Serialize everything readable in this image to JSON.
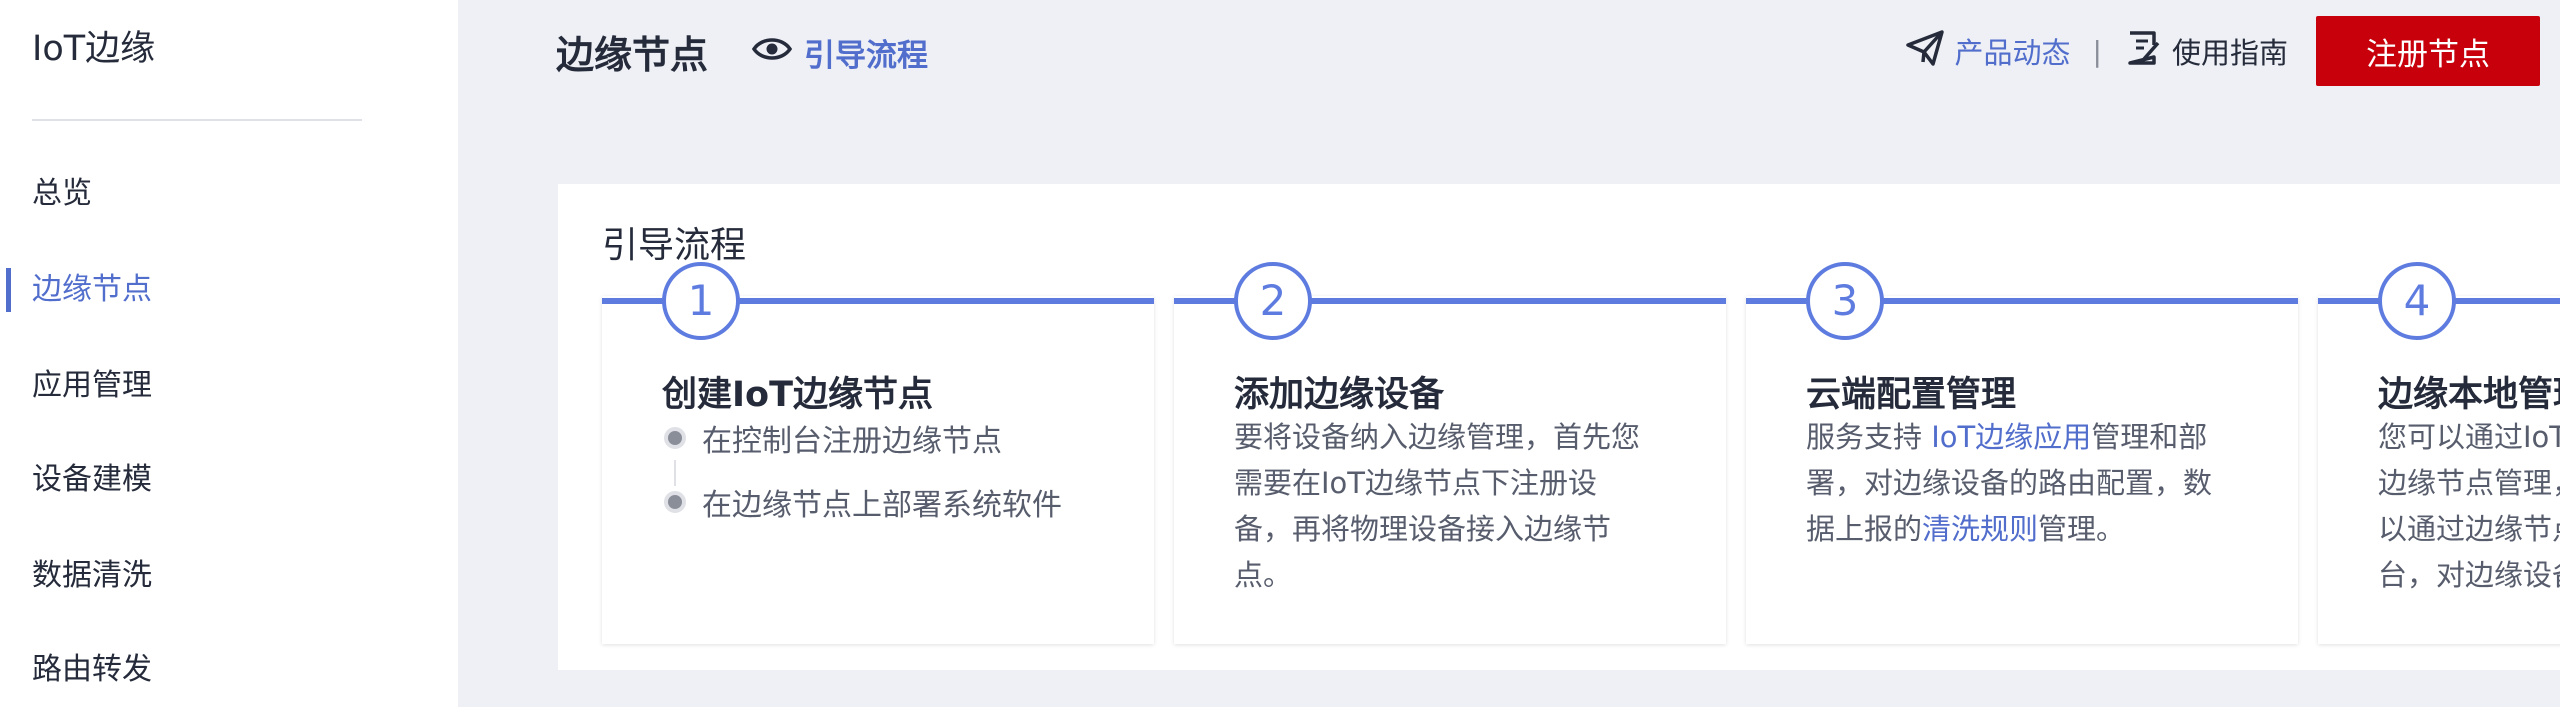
{
  "sidebar": {
    "app_title": "IoT边缘",
    "items": [
      {
        "label": "总览",
        "active": false
      },
      {
        "label": "边缘节点",
        "active": true
      },
      {
        "label": "应用管理",
        "active": false
      },
      {
        "label": "设备建模",
        "active": false
      },
      {
        "label": "数据清洗",
        "active": false
      },
      {
        "label": "路由转发",
        "active": false
      }
    ]
  },
  "header": {
    "title": "边缘节点",
    "guide_link": "引导流程",
    "news_link": "产品动态",
    "separator": "|",
    "guide_doc_link": "使用指南",
    "register_button": "注册节点"
  },
  "guide": {
    "title": "引导流程",
    "steps": [
      {
        "number": "1",
        "title": "创建IoT边缘节点",
        "bullets": [
          "在控制台注册边缘节点",
          "在边缘节点上部署系统软件"
        ]
      },
      {
        "number": "2",
        "title": "添加边缘设备",
        "desc": "要将设备纳入边缘管理，首先您需要在IoT边缘节点下注册设备，再将物理设备接入边缘节点。"
      },
      {
        "number": "3",
        "title": "云端配置管理",
        "desc_pre": "服务支持 ",
        "desc_link1": "IoT边缘应用",
        "desc_mid": "管理和部署，对边缘设备的路由配置，数据上报的",
        "desc_link2": "清洗规则",
        "desc_post": "管理。"
      },
      {
        "number": "4",
        "title": "边缘本地管理",
        "desc": "您可以通过IoT边缘控制台进行边缘节点管理，云端配置，也可以通过边缘节点上的本地管理台，对边缘设备进行管理。"
      }
    ]
  },
  "colors": {
    "accent": "#526ecc",
    "step_line": "#5e7ce0",
    "primary_button": "#c7000b",
    "background": "#eef0f5"
  },
  "icons": {
    "guide_link": "eye-icon",
    "news_link": "paper-plane-icon",
    "guide_doc_link": "edit-document-icon"
  }
}
